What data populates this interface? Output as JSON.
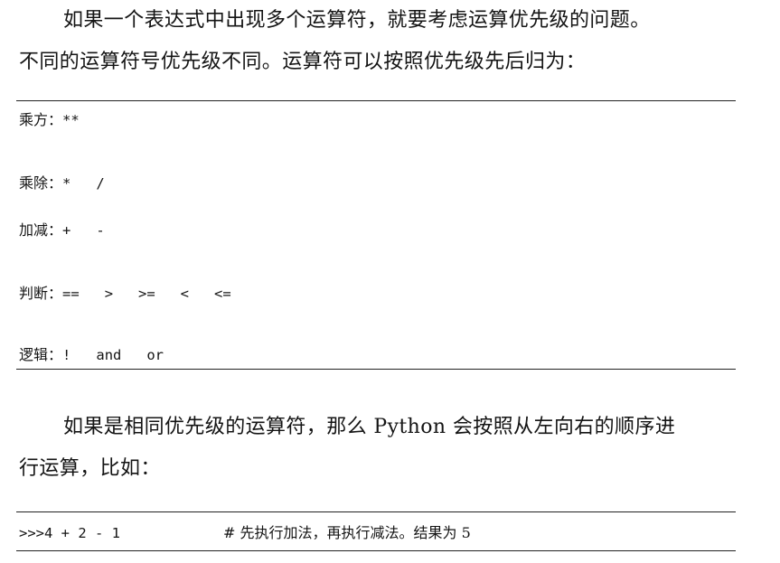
{
  "intro": {
    "line1": "如果一个表达式中出现多个运算符，就要考虑运算优先级的问题。",
    "line2": "不同的运算符号优先级不同。运算符可以按照优先级先后归为："
  },
  "precedence_table": [
    {
      "category": "乘方",
      "colon": "：",
      "ops": "**"
    },
    {
      "category": "乘除",
      "colon": "：",
      "ops": "*   /"
    },
    {
      "category": "加减",
      "colon": "：",
      "ops": "+   -"
    },
    {
      "category": "判断",
      "colon": "：",
      "ops": "==   >   >=   <   <="
    },
    {
      "category": "逻辑",
      "colon": "：",
      "ops": "!   and   or"
    }
  ],
  "explanation": {
    "line1": "如果是相同优先级的运算符，那么 Python 会按照从左向右的顺序进",
    "line2": "行运算，比如："
  },
  "example": {
    "code": ">>>4 + 2 - 1",
    "comment": "# 先执行加法，再执行减法。结果为 5"
  }
}
